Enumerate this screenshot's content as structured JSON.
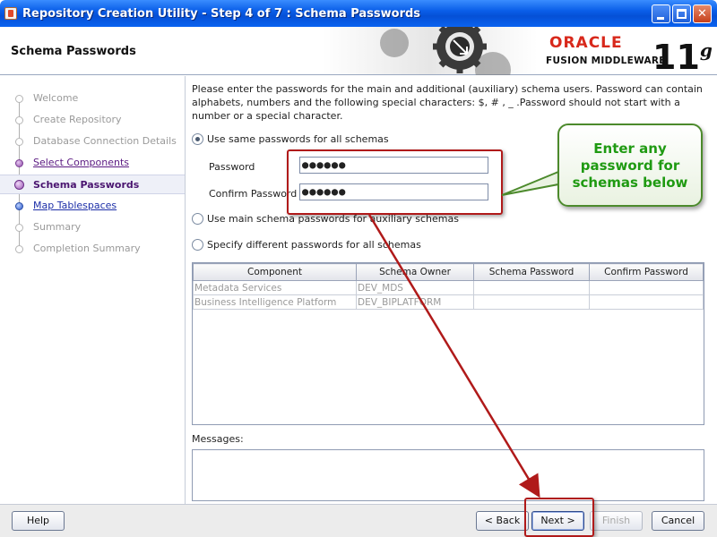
{
  "window": {
    "title": "Repository Creation Utility - Step 4 of 7 : Schema Passwords"
  },
  "header": {
    "page_title": "Schema Passwords",
    "logo_oracle": "ORACLE",
    "logo_product": "FUSION MIDDLEWARE",
    "logo_version": "11",
    "logo_version_sup": "g"
  },
  "sidebar": {
    "items": [
      {
        "label": "Welcome",
        "state": "done"
      },
      {
        "label": "Create Repository",
        "state": "done"
      },
      {
        "label": "Database Connection Details",
        "state": "done"
      },
      {
        "label": "Select Components",
        "state": "visited"
      },
      {
        "label": "Schema Passwords",
        "state": "active"
      },
      {
        "label": "Map Tablespaces",
        "state": "link"
      },
      {
        "label": "Summary",
        "state": "pending"
      },
      {
        "label": "Completion Summary",
        "state": "pending"
      }
    ]
  },
  "main": {
    "instructions": "Please enter the passwords for the main and additional (auxiliary) schema users. Password can contain alphabets, numbers and the following special characters: $, # , _ .Password should not start with a number or a special character.",
    "option_same": "Use same passwords for all schemas",
    "option_main": "Use main schema passwords for auxiliary schemas",
    "option_different": "Specify different passwords for all schemas",
    "password_label": "Password",
    "password_value": "●●●●●●",
    "confirm_label": "Confirm Password",
    "confirm_value": "●●●●●●",
    "table": {
      "headers": [
        "Component",
        "Schema Owner",
        "Schema Password",
        "Confirm Password"
      ],
      "rows": [
        [
          "Metadata Services",
          "DEV_MDS",
          "",
          ""
        ],
        [
          "Business Intelligence Platform",
          "DEV_BIPLATFORM",
          "",
          ""
        ]
      ]
    },
    "messages_label": "Messages:"
  },
  "buttons": {
    "help": "Help",
    "back": "< Back",
    "next": "Next >",
    "finish": "Finish",
    "cancel": "Cancel"
  },
  "annotation": {
    "callout_line1": "Enter any",
    "callout_line2": "password for",
    "callout_line3": "schemas below",
    "highlight_color": "#b01a1a",
    "callout_color": "#1f9a12"
  }
}
